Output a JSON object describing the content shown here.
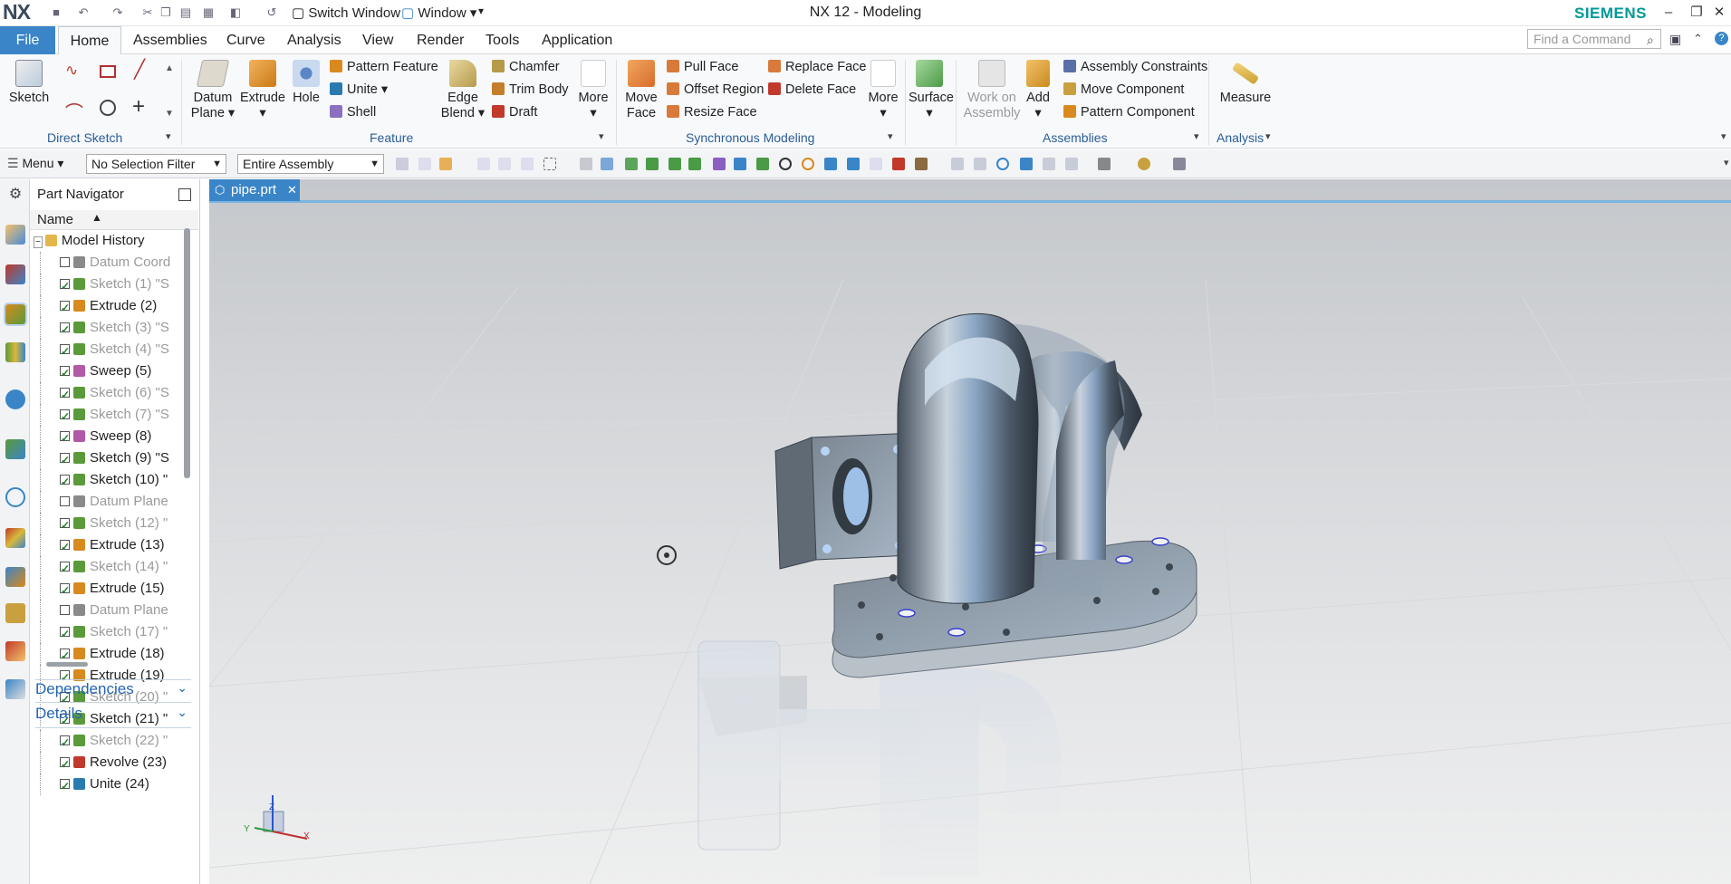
{
  "titlebar": {
    "logo": "NX",
    "switch_window": "Switch Window",
    "window_menu": "Window",
    "title": "NX 12 - Modeling",
    "brand": "SIEMENS",
    "minimize": "–",
    "restore": "❐",
    "close": "✕"
  },
  "menubar": {
    "file": "File",
    "tabs": [
      "Home",
      "Assemblies",
      "Curve",
      "Analysis",
      "View",
      "Render",
      "Tools",
      "Application"
    ],
    "find_placeholder": "Find a Command"
  },
  "ribbon": {
    "direct_sketch": {
      "sketch": "Sketch",
      "group": "Direct Sketch"
    },
    "feature": {
      "datum_plane": "Datum",
      "datum_plane2": "Plane",
      "extrude": "Extrude",
      "hole": "Hole",
      "pattern_feature": "Pattern Feature",
      "unite": "Unite",
      "shell": "Shell",
      "edge_blend": "Edge",
      "edge_blend2": "Blend",
      "chamfer": "Chamfer",
      "trim_body": "Trim Body",
      "draft": "Draft",
      "more": "More",
      "group": "Feature"
    },
    "sync": {
      "move_face": "Move",
      "move_face2": "Face",
      "pull_face": "Pull Face",
      "offset_region": "Offset Region",
      "resize_face": "Resize Face",
      "replace_face": "Replace Face",
      "delete_face": "Delete Face",
      "more": "More",
      "group": "Synchronous Modeling"
    },
    "surface": {
      "label": "Surface"
    },
    "assemblies": {
      "work_on": "Work on",
      "work_on2": "Assembly",
      "add": "Add",
      "constraints": "Assembly Constraints",
      "move_component": "Move Component",
      "pattern_component": "Pattern Component",
      "group": "Assemblies"
    },
    "analysis": {
      "measure": "Measure",
      "group": "Analysis"
    }
  },
  "toolbar2": {
    "menu": "Menu",
    "selection_filter": "No Selection Filter",
    "scope": "Entire Assembly"
  },
  "navigator": {
    "title": "Part Navigator",
    "column": "Name",
    "root": "Model History",
    "items": [
      {
        "label": "Datum Coord",
        "checked": false,
        "active": false,
        "icon": "#8a8a8a"
      },
      {
        "label": "Sketch (1) \"S",
        "checked": true,
        "active": false,
        "icon": "#5a9a3a"
      },
      {
        "label": "Extrude (2)",
        "checked": true,
        "active": true,
        "icon": "#d88a1e"
      },
      {
        "label": "Sketch (3) \"S",
        "checked": true,
        "active": false,
        "icon": "#5a9a3a"
      },
      {
        "label": "Sketch (4) \"S",
        "checked": true,
        "active": false,
        "icon": "#5a9a3a"
      },
      {
        "label": "Sweep (5)",
        "checked": true,
        "active": true,
        "icon": "#b05aa8"
      },
      {
        "label": "Sketch (6) \"S",
        "checked": true,
        "active": false,
        "icon": "#5a9a3a"
      },
      {
        "label": "Sketch (7) \"S",
        "checked": true,
        "active": false,
        "icon": "#5a9a3a"
      },
      {
        "label": "Sweep (8)",
        "checked": true,
        "active": true,
        "icon": "#b05aa8"
      },
      {
        "label": "Sketch (9) \"S",
        "checked": true,
        "active": true,
        "icon": "#5a9a3a"
      },
      {
        "label": "Sketch (10) \"",
        "checked": true,
        "active": true,
        "icon": "#5a9a3a"
      },
      {
        "label": "Datum Plane",
        "checked": false,
        "active": false,
        "icon": "#8a8a8a"
      },
      {
        "label": "Sketch (12) \"",
        "checked": true,
        "active": false,
        "icon": "#5a9a3a"
      },
      {
        "label": "Extrude (13)",
        "checked": true,
        "active": true,
        "icon": "#d88a1e"
      },
      {
        "label": "Sketch (14) \"",
        "checked": true,
        "active": false,
        "icon": "#5a9a3a"
      },
      {
        "label": "Extrude (15)",
        "checked": true,
        "active": true,
        "icon": "#d88a1e"
      },
      {
        "label": "Datum Plane",
        "checked": false,
        "active": false,
        "icon": "#8a8a8a"
      },
      {
        "label": "Sketch (17) \"",
        "checked": true,
        "active": false,
        "icon": "#5a9a3a"
      },
      {
        "label": "Extrude (18)",
        "checked": true,
        "active": true,
        "icon": "#d88a1e"
      },
      {
        "label": "Extrude (19)",
        "checked": true,
        "active": true,
        "icon": "#d88a1e"
      },
      {
        "label": "Sketch (20) \"",
        "checked": true,
        "active": false,
        "icon": "#5a9a3a"
      },
      {
        "label": "Sketch (21) \"",
        "checked": true,
        "active": true,
        "icon": "#5a9a3a"
      },
      {
        "label": "Sketch (22) \"",
        "checked": true,
        "active": false,
        "icon": "#5a9a3a"
      },
      {
        "label": "Revolve (23)",
        "checked": true,
        "active": true,
        "icon": "#c0392b"
      },
      {
        "label": "Unite (24)",
        "checked": true,
        "active": true,
        "icon": "#2a7ab0"
      }
    ],
    "dependencies": "Dependencies",
    "details": "Details"
  },
  "viewport": {
    "tab": "pipe.prt",
    "axis_x": "X",
    "axis_y": "Y",
    "axis_z": "Z"
  }
}
